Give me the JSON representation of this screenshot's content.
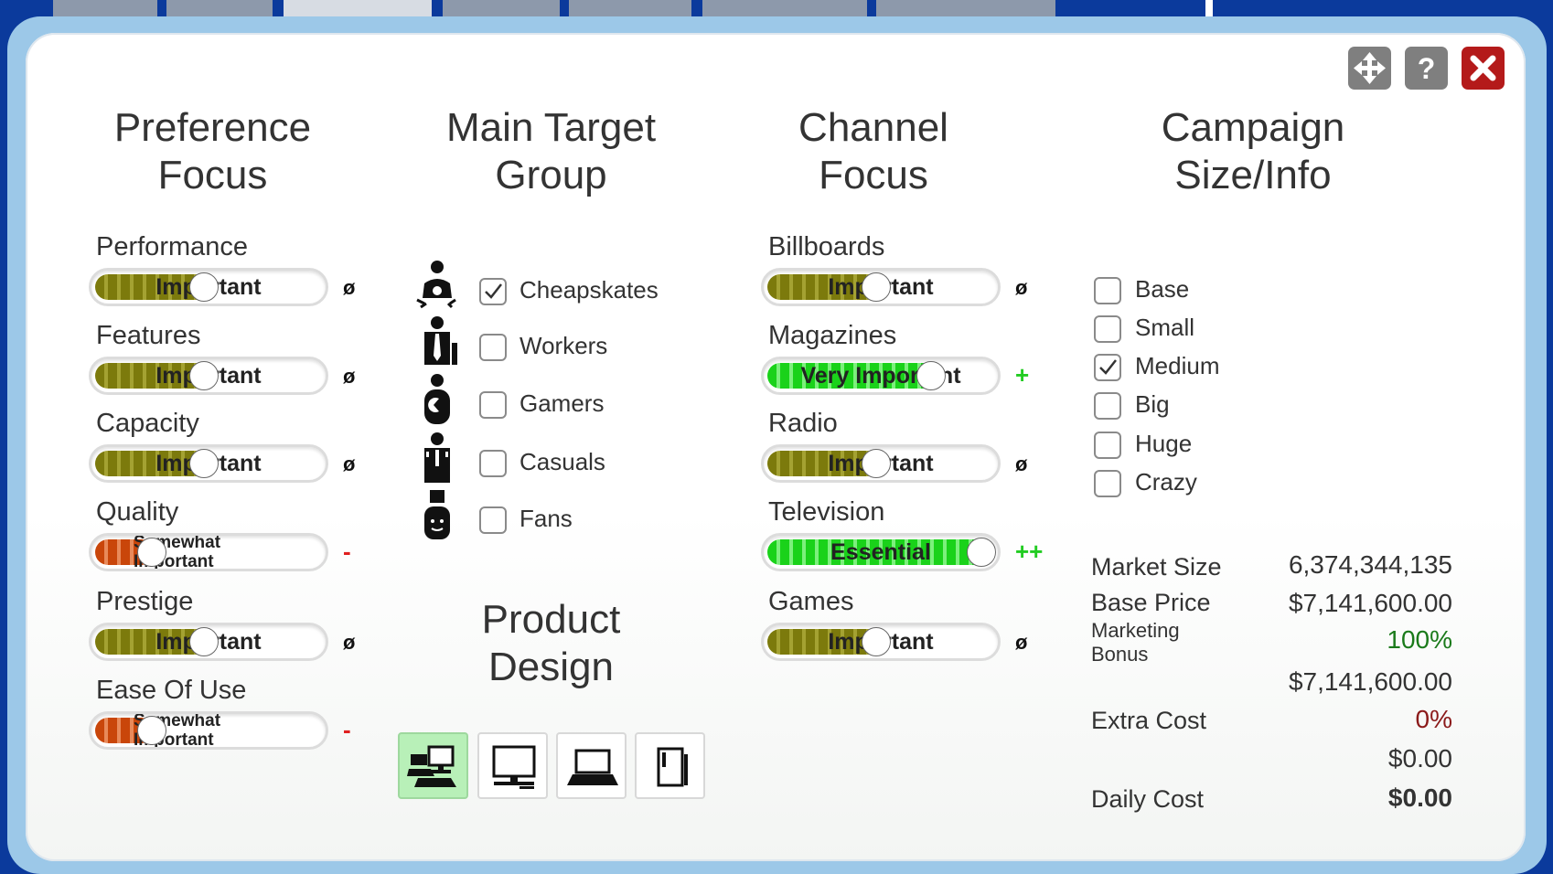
{
  "colors": {
    "olive": "#7c7a0c",
    "orange": "#c9460a",
    "green": "#1ad21a",
    "bonus": "#1a7a1a",
    "extra": "#8b1a1a",
    "close": "#b41a1a"
  },
  "window": {
    "move_icon": "move-arrows-icon",
    "help_icon": "question-icon",
    "close_icon": "close-x-icon"
  },
  "columns": {
    "preference_title": [
      "Preference",
      "Focus"
    ],
    "target_title": [
      "Main Target",
      "Group"
    ],
    "channel_title": [
      "Channel",
      "Focus"
    ],
    "campaign_title": [
      "Campaign",
      "Size/Info"
    ],
    "design_title": [
      "Product",
      "Design"
    ]
  },
  "preferences": [
    {
      "name": "Performance",
      "level": "Important",
      "fill_pct": 48,
      "style": "olive",
      "indicator": "ø"
    },
    {
      "name": "Features",
      "level": "Important",
      "fill_pct": 48,
      "style": "olive",
      "indicator": "ø"
    },
    {
      "name": "Capacity",
      "level": "Important",
      "fill_pct": 48,
      "style": "olive",
      "indicator": "ø"
    },
    {
      "name": "Quality",
      "level_line1": "Somewhat",
      "level_line2": "Important",
      "fill_pct": 25,
      "style": "orange",
      "indicator": "-"
    },
    {
      "name": "Prestige",
      "level": "Important",
      "fill_pct": 48,
      "style": "olive",
      "indicator": "ø"
    },
    {
      "name": "Ease Of Use",
      "level_line1": "Somewhat",
      "level_line2": "Important",
      "fill_pct": 25,
      "style": "orange",
      "indicator": "-"
    }
  ],
  "target_groups": [
    {
      "label": "Cheapskates",
      "checked": true,
      "icon": "cheapskate-person-icon"
    },
    {
      "label": "Workers",
      "checked": false,
      "icon": "worker-person-icon"
    },
    {
      "label": "Gamers",
      "checked": false,
      "icon": "gamer-person-icon"
    },
    {
      "label": "Casuals",
      "checked": false,
      "icon": "casual-person-icon"
    },
    {
      "label": "Fans",
      "checked": false,
      "icon": "fan-person-icon"
    }
  ],
  "channels": [
    {
      "name": "Billboards",
      "level": "Important",
      "fill_pct": 48,
      "style": "olive",
      "indicator": "ø"
    },
    {
      "name": "Magazines",
      "level": "Very Important",
      "fill_pct": 72,
      "style": "green",
      "indicator": "+"
    },
    {
      "name": "Radio",
      "level": "Important",
      "fill_pct": 48,
      "style": "olive",
      "indicator": "ø"
    },
    {
      "name": "Television",
      "level": "Essential",
      "fill_pct": 96,
      "style": "green",
      "indicator": "++"
    },
    {
      "name": "Games",
      "level": "Important",
      "fill_pct": 48,
      "style": "olive",
      "indicator": "ø"
    }
  ],
  "sizes": [
    {
      "label": "Base",
      "checked": false
    },
    {
      "label": "Small",
      "checked": false
    },
    {
      "label": "Medium",
      "checked": true
    },
    {
      "label": "Big",
      "checked": false
    },
    {
      "label": "Huge",
      "checked": false
    },
    {
      "label": "Crazy",
      "checked": false
    }
  ],
  "info": {
    "market_size_label": "Market Size",
    "market_size_value": "6,374,344,135",
    "base_price_label": "Base Price",
    "base_price_value": "$7,141,600.00",
    "marketing_bonus_label1": "Marketing",
    "marketing_bonus_label2": "Bonus",
    "marketing_bonus_pct": "100%",
    "marketing_bonus_value": "$7,141,600.00",
    "extra_cost_label": "Extra Cost",
    "extra_cost_pct": "0%",
    "extra_cost_value": "$0.00",
    "daily_cost_label": "Daily Cost",
    "daily_cost_value": "$0.00"
  },
  "product_designs": [
    {
      "icon": "desktop-and-laptop-icon",
      "selected": true
    },
    {
      "icon": "desktop-computer-icon",
      "selected": false
    },
    {
      "icon": "laptop-icon",
      "selected": false
    },
    {
      "icon": "tablet-phone-icon",
      "selected": false
    }
  ]
}
